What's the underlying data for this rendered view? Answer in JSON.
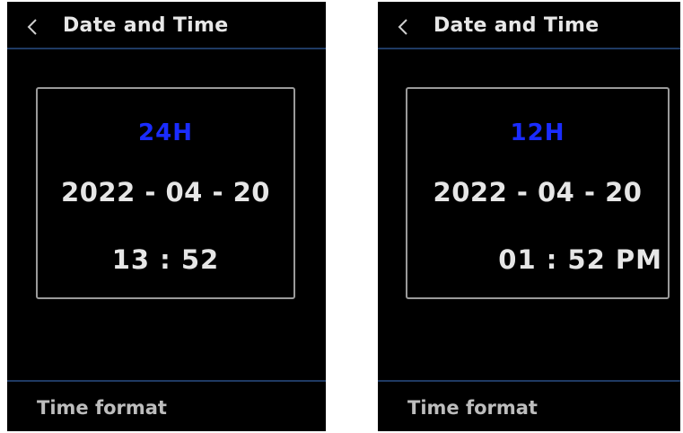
{
  "screens": [
    {
      "title": "Date and Time",
      "format": "24H",
      "date": "2022 - 04 - 20",
      "time": "13 : 52",
      "footer": "Time format",
      "back_icon": "chevron-left-icon"
    },
    {
      "title": "Date and Time",
      "format": "12H",
      "date": "2022 - 04 - 20",
      "time": "01 : 52 PM",
      "footer": "Time format",
      "back_icon": "chevron-left-icon"
    }
  ],
  "colors": {
    "background": "#000000",
    "accent": "#1a2cff",
    "divider": "#1f3a63",
    "text": "#e6e6e6",
    "card_border": "#9a9a9a"
  }
}
